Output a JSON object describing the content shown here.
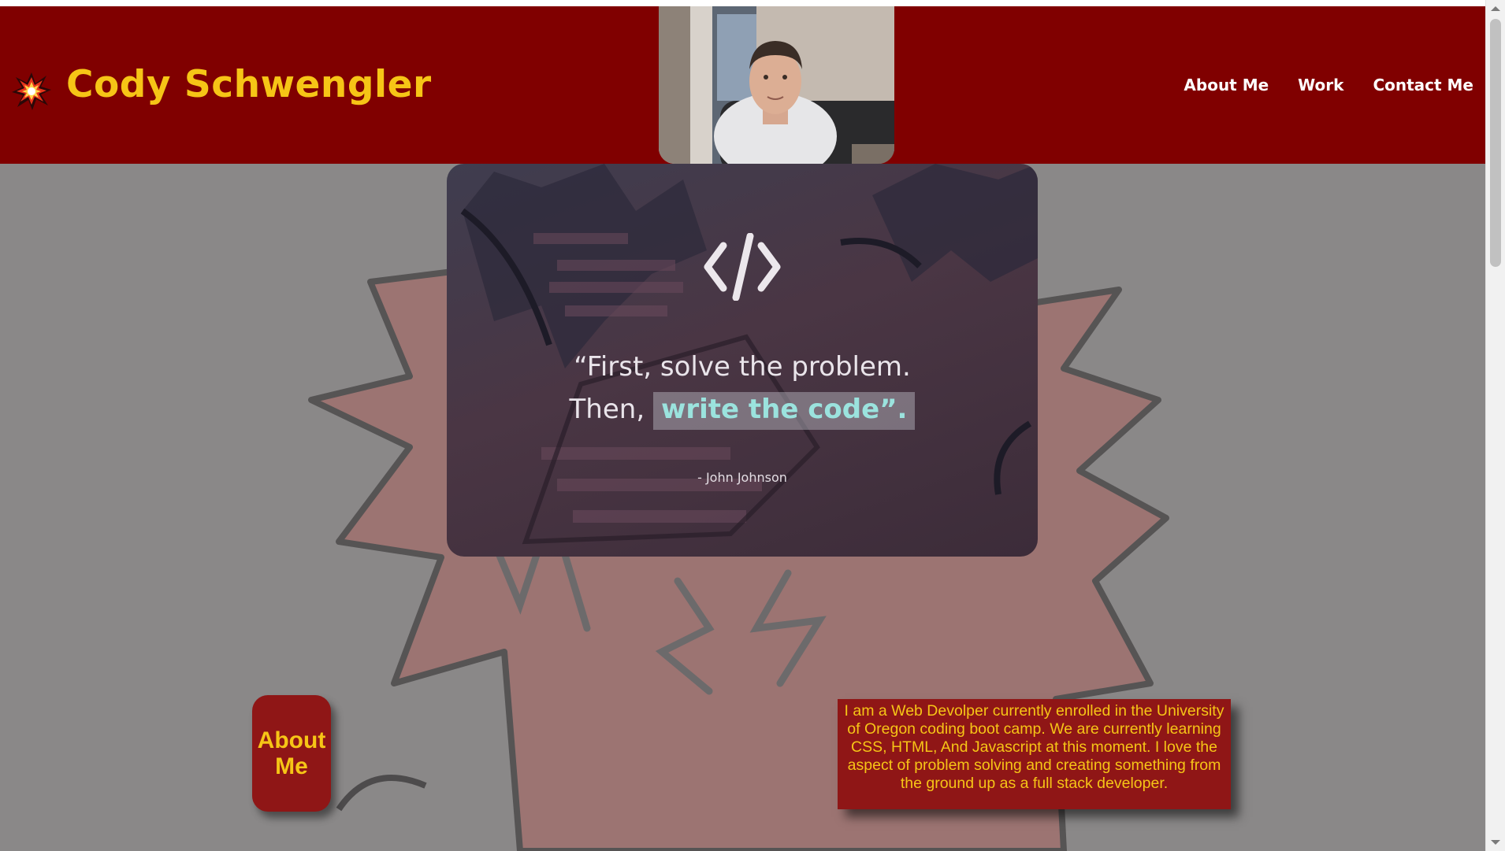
{
  "header": {
    "title": "Cody Schwengler",
    "logo_icon": "explosion-icon",
    "profile_photo": "profile-photo",
    "nav": [
      {
        "label": "About Me"
      },
      {
        "label": "Work"
      },
      {
        "label": "Contact Me"
      }
    ]
  },
  "hero": {
    "icon": "code-brackets-icon",
    "quote_line1": "“First, solve the problem.",
    "quote_line2_pre": "Then, ",
    "quote_line2_highlight": "write the code",
    "quote_line2_post": "”.",
    "author": "- John Johnson"
  },
  "about": {
    "button_label_line1": "About",
    "button_label_line2": "Me",
    "bio": "I am a Web Devolper currently enrolled in the University of Oregon coding boot camp. We are currently learning CSS, HTML, And Javascript at this moment. I love the aspect of problem solving and creating something from the ground up as a full stack developer."
  },
  "colors": {
    "header_bg": "#800000",
    "accent_yellow": "#f6c516",
    "page_bg": "#8a8888",
    "card_red": "#8f1616"
  }
}
